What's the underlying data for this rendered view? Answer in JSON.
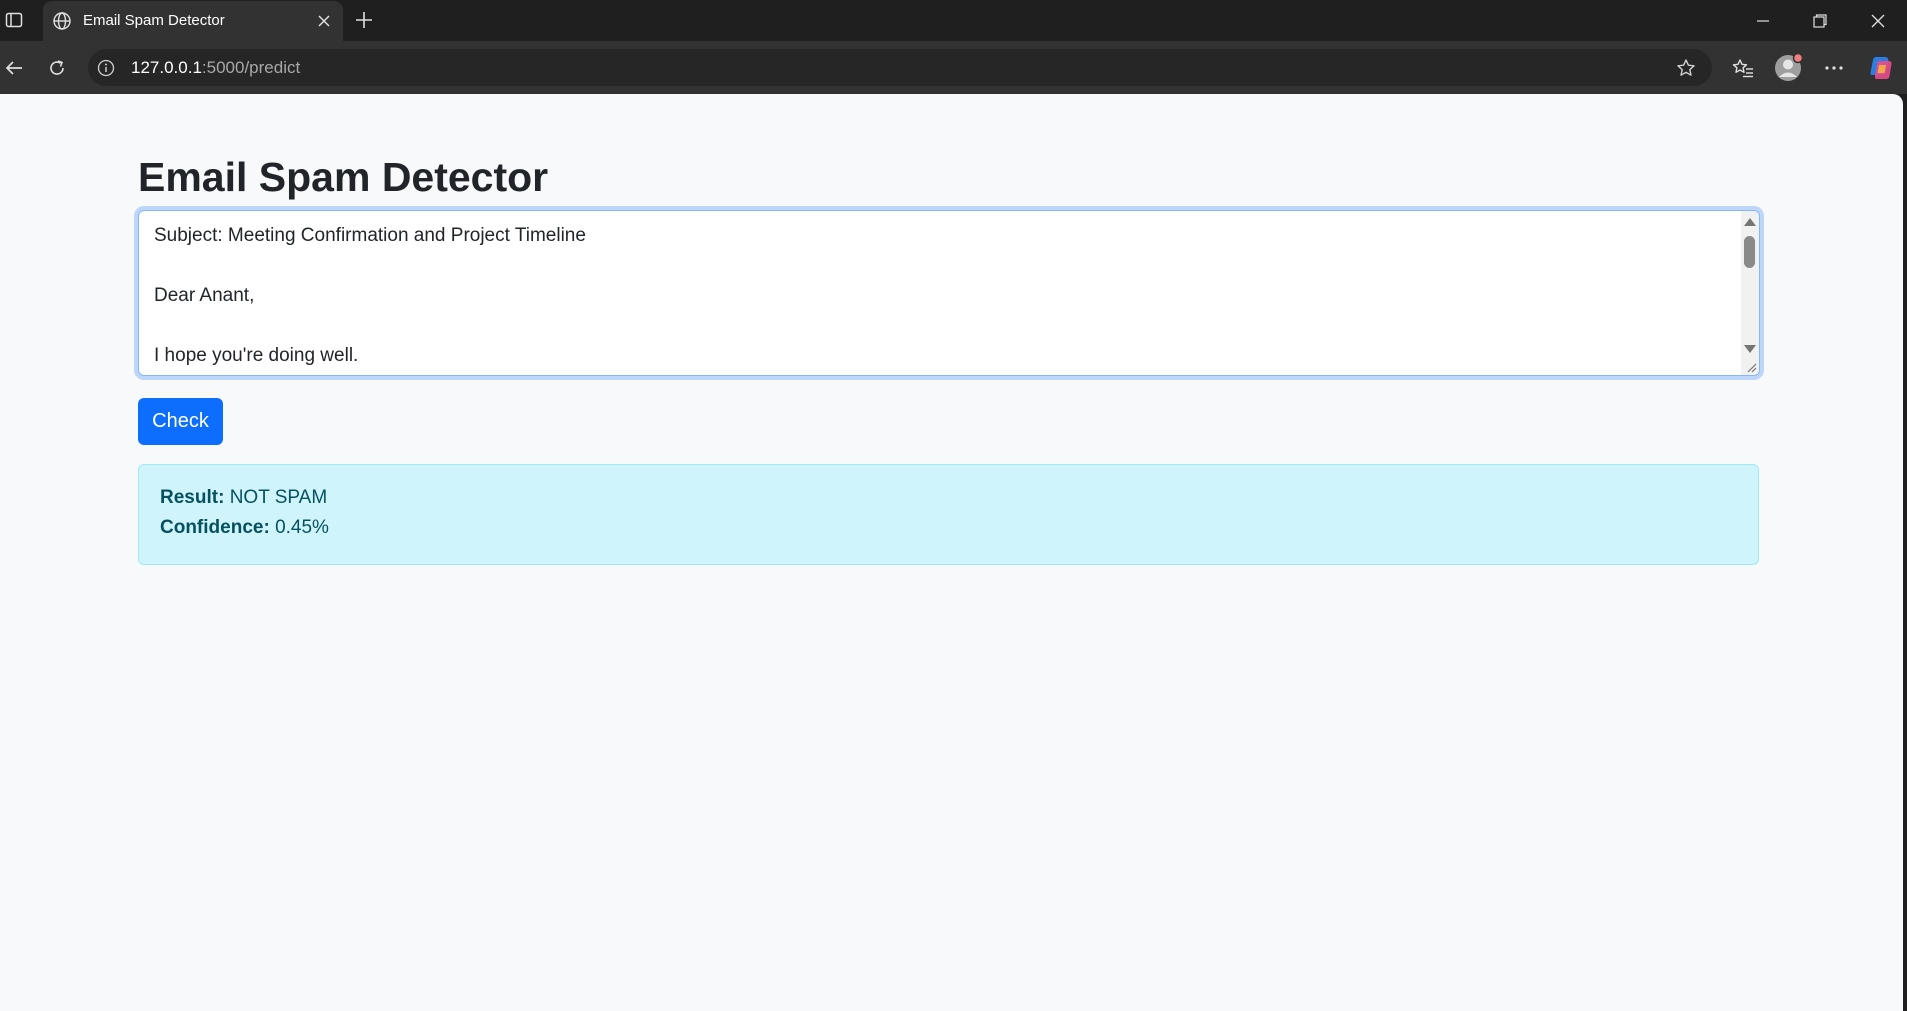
{
  "browser": {
    "tab_title": "Email Spam Detector",
    "url_host": "127.0.0.1",
    "url_path": ":5000/predict"
  },
  "page": {
    "heading": "Email Spam Detector",
    "email_text": "Subject: Meeting Confirmation and Project Timeline\n\nDear Anant,\n\nI hope you're doing well.",
    "check_label": "Check",
    "result_label": "Result:",
    "result_value": "NOT SPAM",
    "confidence_label": "Confidence:",
    "confidence_value": "0.45%"
  },
  "colors": {
    "accent": "#0d6efd",
    "alert_bg": "#cff4fc",
    "alert_text": "#055160",
    "page_bg": "#f8f9fa"
  }
}
